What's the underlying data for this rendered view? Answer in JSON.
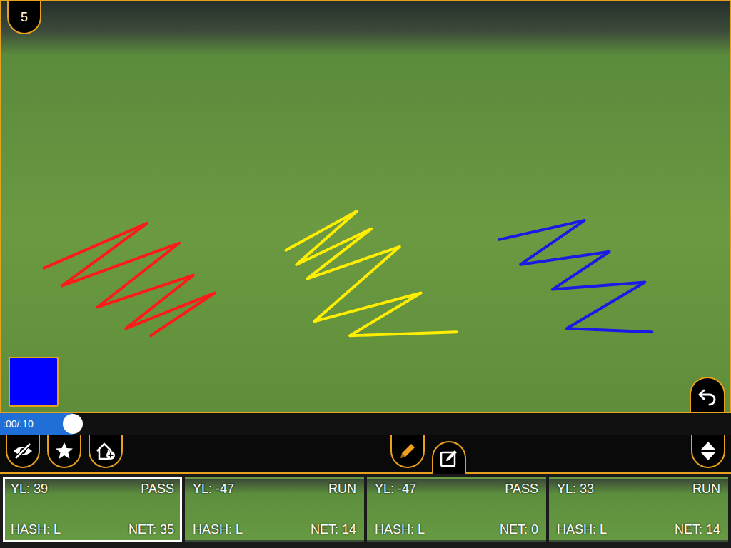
{
  "clip_number": "5",
  "annotations": [
    {
      "color": "#ff1a1a"
    },
    {
      "color": "#ffee00"
    },
    {
      "color": "#1a1ae6"
    }
  ],
  "pen": {
    "color": "#0000ff"
  },
  "timeline": {
    "reading": ":00/:10",
    "level": 0.1
  },
  "left_tools": [
    {
      "kind": "hide",
      "selected": false
    },
    {
      "kind": "star",
      "selected": false
    },
    {
      "kind": "house-plus",
      "selected": false
    }
  ],
  "center_tools": [
    {
      "kind": "pencil",
      "selected": true
    },
    {
      "kind": "note",
      "selected": false
    }
  ],
  "right_tools": [
    {
      "kind": "up-down",
      "selected": false
    }
  ],
  "clips": [
    {
      "yard_line": "YL: 39",
      "play_type": "PASS",
      "hash": "HASH: L",
      "net": "NET: 35",
      "selected": true
    },
    {
      "yard_line": "YL: -47",
      "play_type": "RUN",
      "hash": "HASH: L",
      "net": "NET: 14",
      "selected": false
    },
    {
      "yard_line": "YL: -47",
      "play_type": "PASS",
      "hash": "HASH: L",
      "net": "NET: 0",
      "selected": false
    },
    {
      "yard_line": "YL: 33",
      "play_type": "RUN",
      "hash": "HASH: L",
      "net": "NET: 14",
      "selected": false
    }
  ]
}
